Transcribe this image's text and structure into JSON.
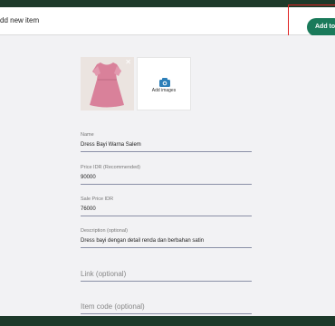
{
  "header": {
    "title": "dd new item",
    "add_button_label": "Add to"
  },
  "images": {
    "add_label": "Add images"
  },
  "fields": {
    "name": {
      "label": "Name",
      "value": "Dress Bayi Warna Salem"
    },
    "price": {
      "label": "Price IDR (Recommended)",
      "value": "90000"
    },
    "sale_price": {
      "label": "Sale Price IDR",
      "value": "76000"
    },
    "description": {
      "label": "Description (optional)",
      "value": "Dress bayi dengan detail renda dan berbahan satin"
    },
    "link": {
      "placeholder": "Link (optional)"
    },
    "item_code": {
      "placeholder": "Item code (optional)"
    }
  },
  "colors": {
    "accent": "#1a7a5a",
    "highlight": "#e02020",
    "dress": "#d9819a"
  }
}
